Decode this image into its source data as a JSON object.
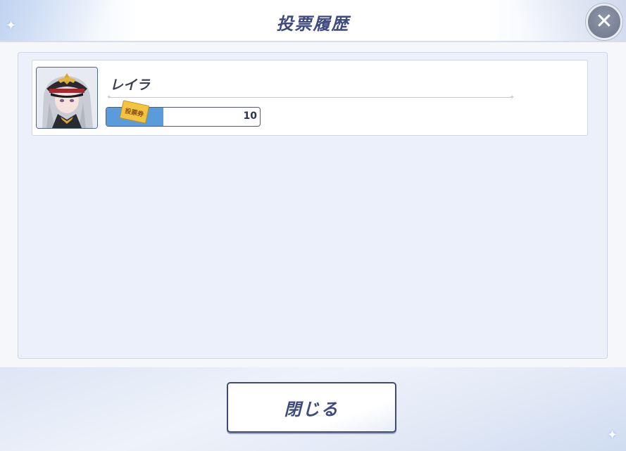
{
  "dialog": {
    "title": "投票履歴",
    "close_icon": "close-icon"
  },
  "history": {
    "entries": [
      {
        "name": "レイラ",
        "ticket_label": "投票券",
        "vote_count": "10",
        "vote_fill_fraction": 0.37
      }
    ]
  },
  "footer": {
    "close_label": "閉じる"
  },
  "colors": {
    "accent": "#3f4a7e",
    "bar_fill": "#5a9bdc",
    "ticket": "#f3c440"
  }
}
